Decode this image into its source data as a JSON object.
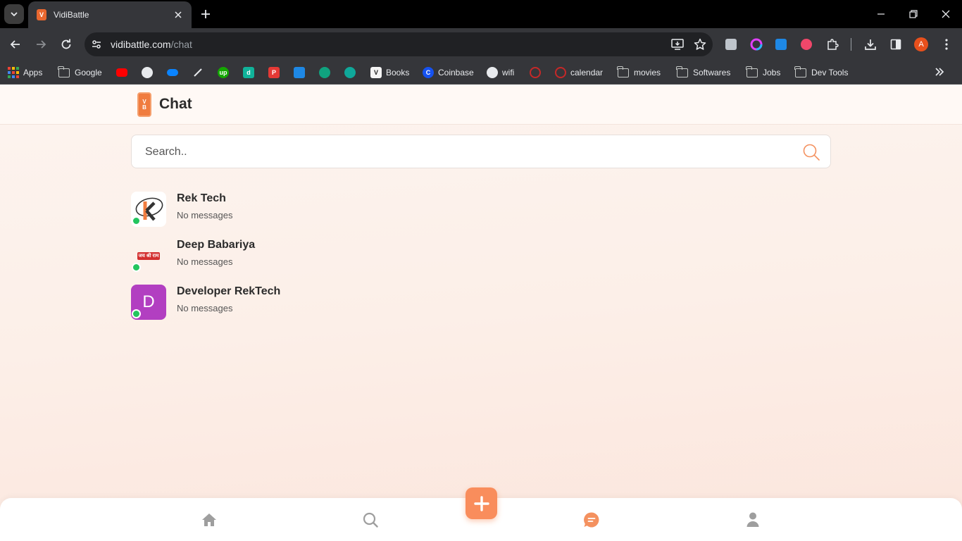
{
  "browser": {
    "tab_title": "VidiBattle",
    "url_domain": "vidibattle.com",
    "url_path": "/chat",
    "profile_initial": "A"
  },
  "bookmarks": {
    "apps": "Apps",
    "google": "Google",
    "books": "Books",
    "coinbase": "Coinbase",
    "wifi": "wifi",
    "calendar": "calendar",
    "movies": "movies",
    "softwares": "Softwares",
    "jobs": "Jobs",
    "dev_tools": "Dev Tools"
  },
  "app": {
    "title": "Chat",
    "accent_color": "#f98d5c"
  },
  "search": {
    "placeholder": "Search.."
  },
  "chats": [
    {
      "name": "Rek Tech",
      "preview": "No messages",
      "online": true
    },
    {
      "name": "Deep Babariya",
      "preview": "No messages",
      "online": true,
      "avatar_text": "जय श्री राम"
    },
    {
      "name": "Developer RekTech",
      "preview": "No messages",
      "online": true,
      "avatar_letter": "D"
    }
  ],
  "bottom_nav": {
    "items": [
      "home-icon",
      "search-icon",
      "create-icon",
      "chat-icon",
      "profile-icon"
    ],
    "active": "chat-icon"
  }
}
